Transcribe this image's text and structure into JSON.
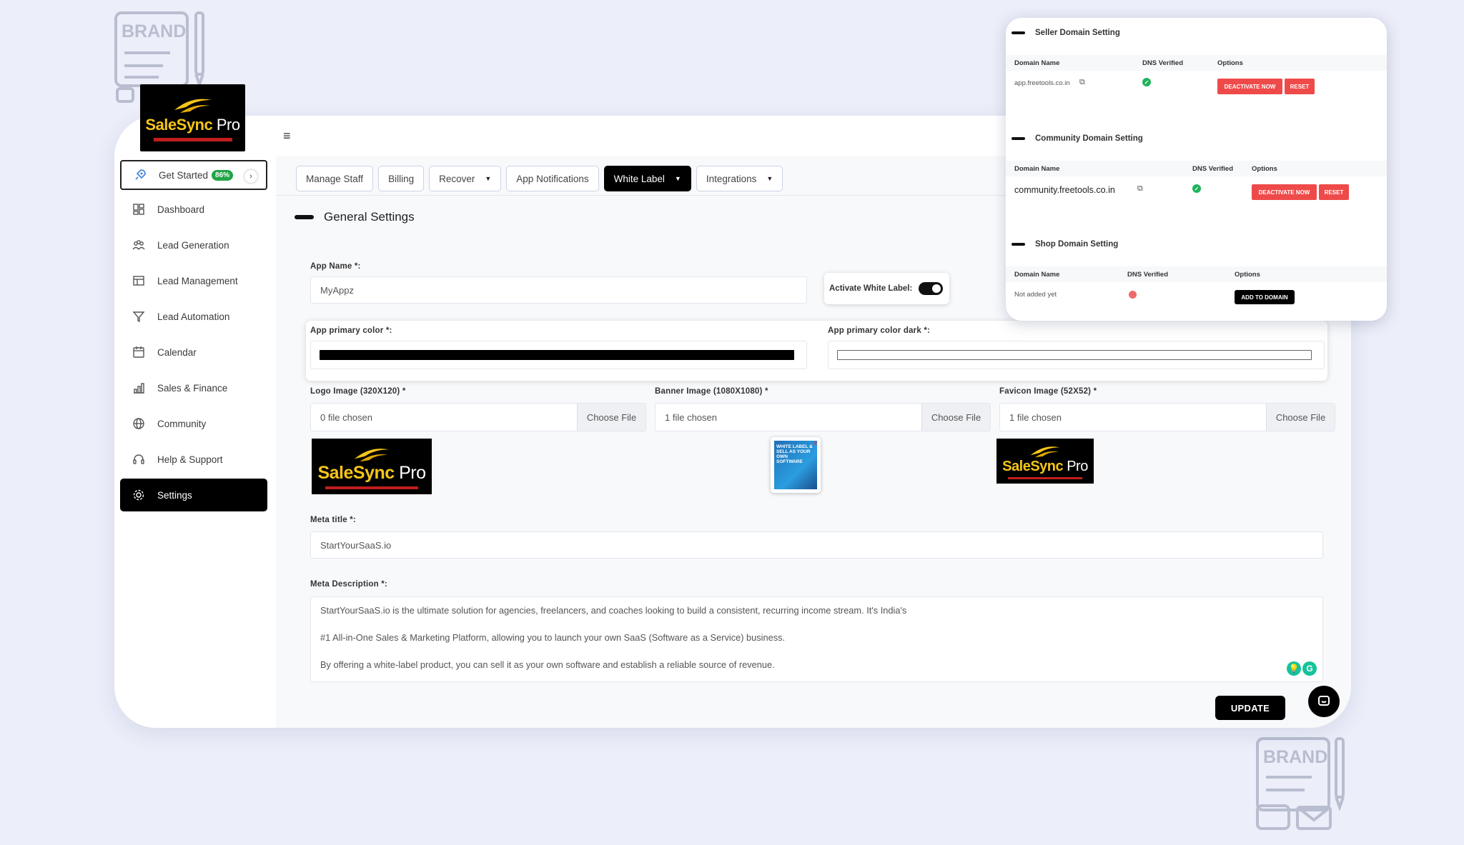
{
  "brand": {
    "logo_text_a": "SaleSync",
    "logo_text_b": "Pro",
    "deco_text": "BRAND"
  },
  "sidebar": {
    "get_started": {
      "label": "Get Started",
      "progress": "86%"
    },
    "items": [
      {
        "label": "Dashboard",
        "icon": "dashboard-icon"
      },
      {
        "label": "Lead Generation",
        "icon": "users-icon"
      },
      {
        "label": "Lead Management",
        "icon": "table-icon"
      },
      {
        "label": "Lead Automation",
        "icon": "funnel-icon"
      },
      {
        "label": "Calendar",
        "icon": "calendar-icon"
      },
      {
        "label": "Sales & Finance",
        "icon": "chart-icon"
      },
      {
        "label": "Community",
        "icon": "globe-icon"
      },
      {
        "label": "Help & Support",
        "icon": "headset-icon"
      },
      {
        "label": "Settings",
        "icon": "gear-icon",
        "active": true
      }
    ]
  },
  "tabs": [
    {
      "label": "Manage Staff"
    },
    {
      "label": "Billing"
    },
    {
      "label": "Recover",
      "dropdown": true
    },
    {
      "label": "App Notifications"
    },
    {
      "label": "White Label",
      "dropdown": true,
      "active": true
    },
    {
      "label": "Integrations",
      "dropdown": true
    }
  ],
  "general": {
    "title": "General Settings",
    "app_name_label": "App Name *:",
    "app_name_value": "MyAppz",
    "white_label_toggle_label": "Activate White Label:",
    "white_label_enabled": true,
    "primary_color_label": "App primary color *:",
    "primary_color_value": "#000000",
    "primary_color_dark_label": "App primary color dark *:",
    "primary_color_dark_value": "#ffffff",
    "logo_label": "Logo Image (320X120) *",
    "logo_file": "0 file chosen",
    "banner_label": "Banner Image (1080X1080) *",
    "banner_file": "1 file chosen",
    "banner_text": "WHITE LABEL & SELL AS YOUR OWN SOFTWARE",
    "favicon_label": "Favicon Image (52X52) *",
    "favicon_file": "1 file chosen",
    "choose_file": "Choose File",
    "meta_title_label": "Meta title *:",
    "meta_title_value": "StartYourSaaS.io",
    "meta_desc_label": "Meta Description *:",
    "meta_desc_lines": [
      "StartYourSaaS.io is the ultimate solution for agencies, freelancers, and coaches looking to build a consistent, recurring income stream. It's India's",
      "#1 All-in-One Sales & Marketing Platform, allowing you to launch your own SaaS (Software as a Service) business.",
      "By offering a white-label product, you can sell it as your own software and establish a reliable source of revenue."
    ],
    "update_button": "UPDATE"
  },
  "domains": {
    "seller": {
      "title": "Seller Domain Setting",
      "col_name": "Domain Name",
      "col_dns": "DNS Verified",
      "col_options": "Options",
      "domain": "app.freetools.co.in",
      "verified": true,
      "deactivate": "DEACTIVATE NOW",
      "reset": "RESET"
    },
    "community": {
      "title": "Community Domain Setting",
      "col_name": "Domain Name",
      "col_dns": "DNS Verified",
      "col_options": "Options",
      "domain": "community.freetools.co.in",
      "verified": true,
      "deactivate": "DEACTIVATE NOW",
      "reset": "RESET"
    },
    "shop": {
      "title": "Shop Domain Setting",
      "col_name": "Domain Name",
      "col_dns": "DNS Verified",
      "col_options": "Options",
      "domain": "Not added yet",
      "verified": false,
      "add": "ADD TO DOMAIN"
    }
  },
  "colors": {
    "accent": "#000000",
    "success": "#21b35b",
    "danger": "#ef4a4a",
    "badge": "#22a447",
    "page_bg": "#eceef9"
  }
}
